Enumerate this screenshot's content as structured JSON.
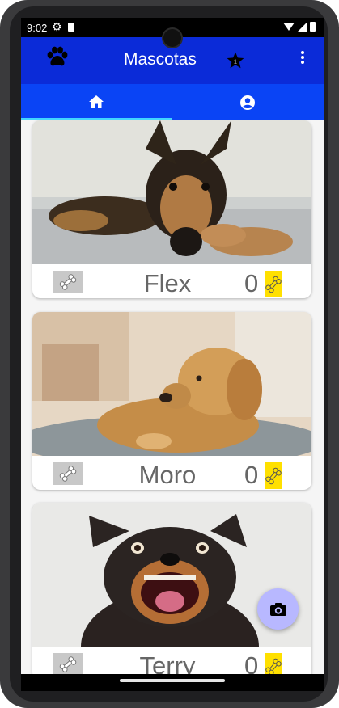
{
  "status": {
    "time": "9:02"
  },
  "appbar": {
    "title": "Mascotas",
    "star_badge": "1"
  },
  "tabs": [
    {
      "icon": "home-icon",
      "selected": true
    },
    {
      "icon": "profile-icon",
      "selected": false
    }
  ],
  "pets": [
    {
      "name": "Flex",
      "likes": "0"
    },
    {
      "name": "Moro",
      "likes": "0"
    },
    {
      "name": "Terry",
      "likes": "0"
    }
  ],
  "colors": {
    "appbar": "#0b2bd8",
    "tabbar": "#0a44f5",
    "tab_indicator": "#42d6ff",
    "like_button": "#ffe000",
    "fab": "#b8b8ff"
  }
}
